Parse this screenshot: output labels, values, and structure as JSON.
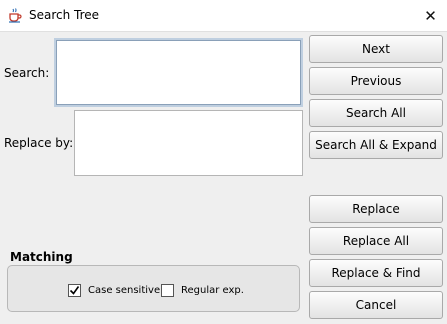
{
  "window": {
    "title": "Search Tree",
    "close_symbol": "✕"
  },
  "search": {
    "label": "Search:",
    "value": ""
  },
  "replace": {
    "label": "Replace by:",
    "value": ""
  },
  "buttons": {
    "next": "Next",
    "previous": "Previous",
    "search_all": "Search All",
    "search_all_expand": "Search All & Expand",
    "replace": "Replace",
    "replace_all": "Replace All",
    "replace_find": "Replace & Find",
    "cancel": "Cancel"
  },
  "matching": {
    "title": "Matching",
    "case_sensitive": {
      "label": "Case sensitive",
      "checked": true
    },
    "regular_exp": {
      "label": "Regular exp.",
      "checked": false
    }
  },
  "icons": {
    "title_icon": "java-coffee-cup-icon",
    "close_icon": "close-icon",
    "check_icon": "checkmark-icon"
  }
}
